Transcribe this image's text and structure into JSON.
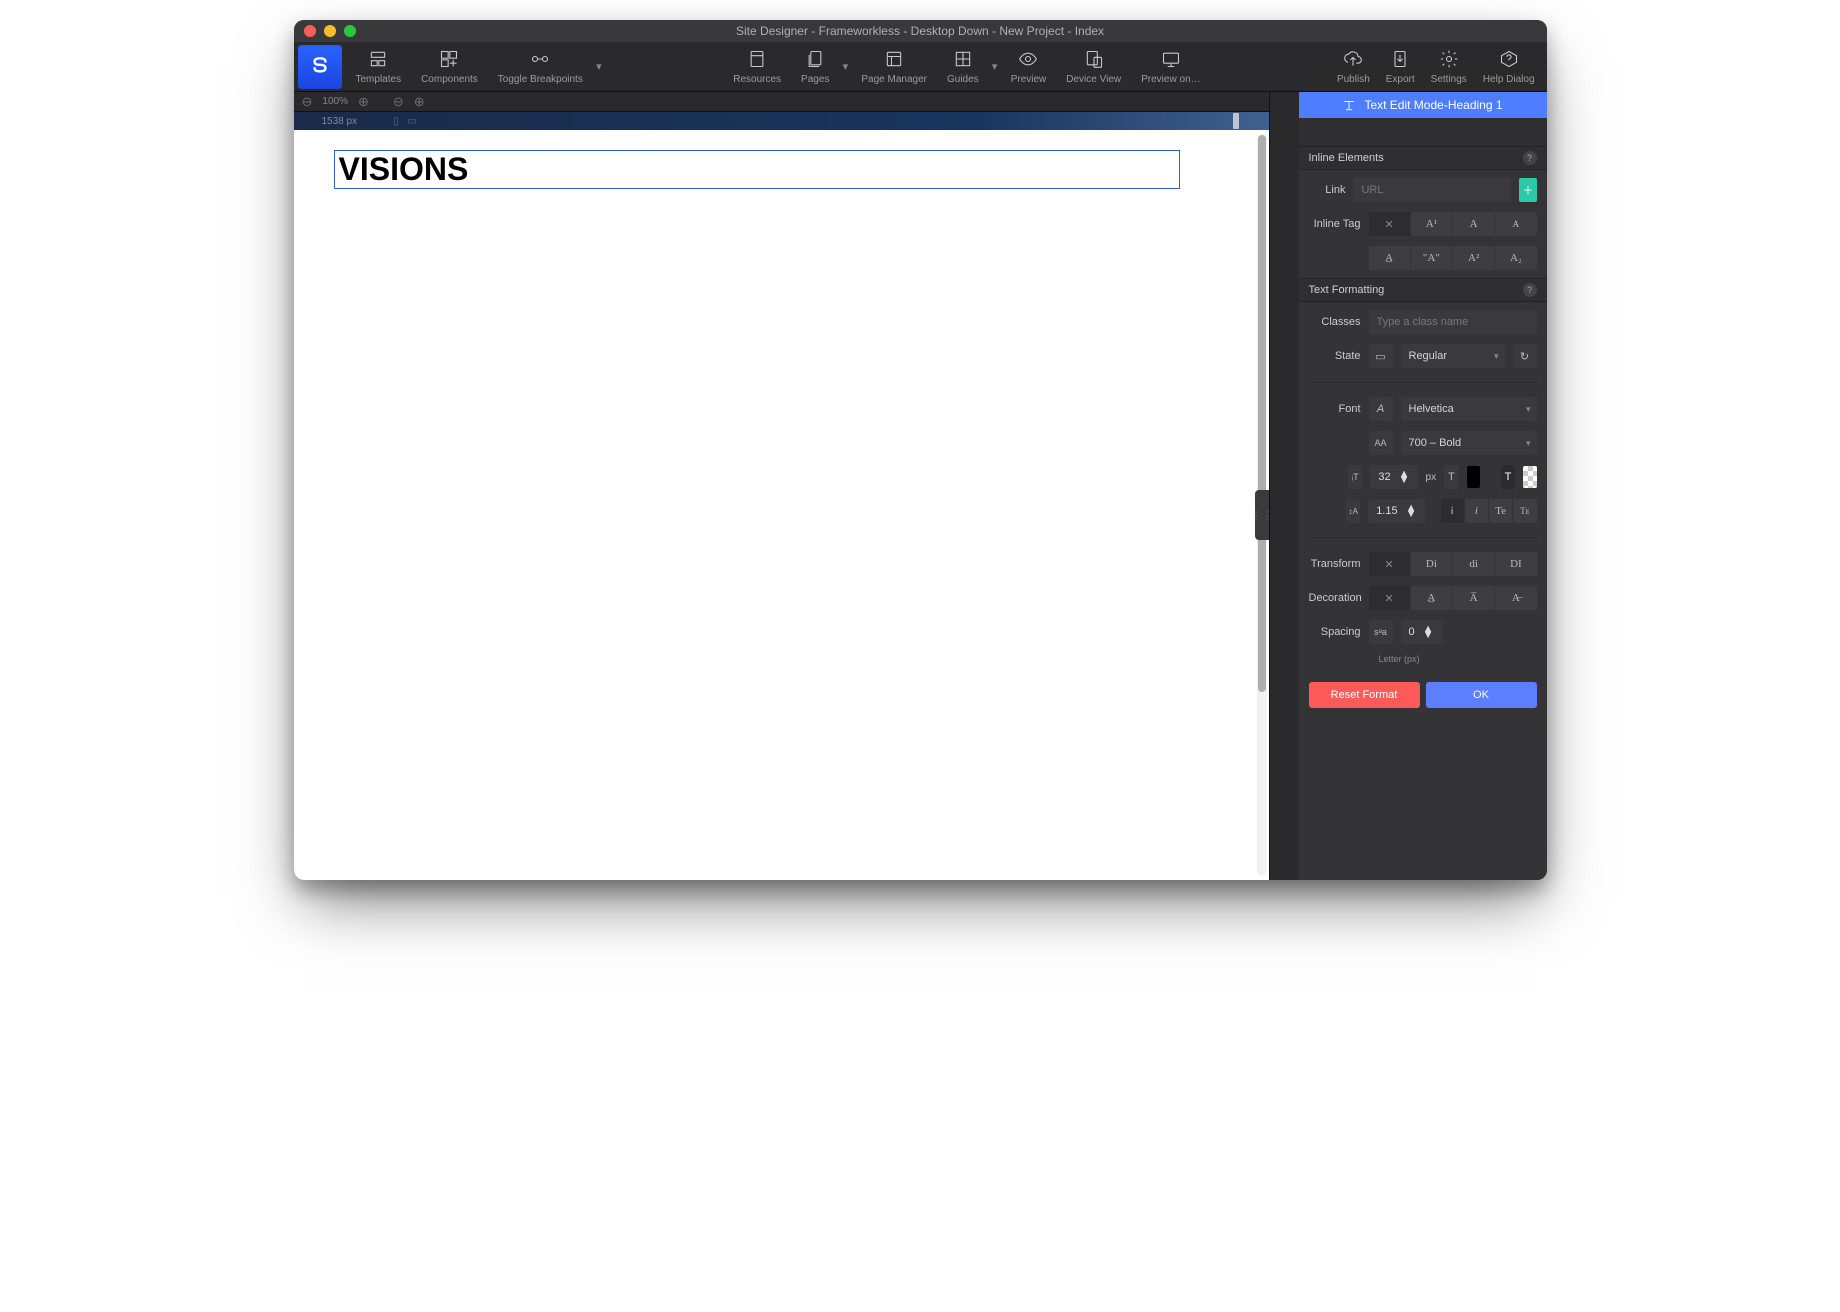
{
  "title": "Site Designer - Frameworkless - Desktop Down - New Project - Index",
  "toolbar_left": [
    {
      "label": "Templates",
      "icon": "templates"
    },
    {
      "label": "Components",
      "icon": "components"
    },
    {
      "label": "Toggle Breakpoints",
      "icon": "breakpoints"
    }
  ],
  "toolbar_center": [
    {
      "label": "Resources",
      "icon": "resources"
    },
    {
      "label": "Pages",
      "icon": "pages",
      "caret": true
    },
    {
      "label": "Page Manager",
      "icon": "pagemgr"
    },
    {
      "label": "Guides",
      "icon": "guides",
      "caret": true
    },
    {
      "label": "Preview",
      "icon": "preview"
    },
    {
      "label": "Device View",
      "icon": "device"
    },
    {
      "label": "Preview on…",
      "icon": "previewon"
    }
  ],
  "toolbar_right": [
    {
      "label": "Publish",
      "icon": "publish"
    },
    {
      "label": "Export",
      "icon": "export"
    },
    {
      "label": "Settings",
      "icon": "settings"
    },
    {
      "label": "Help Dialog",
      "icon": "help"
    }
  ],
  "zoom": {
    "percent": "100%"
  },
  "breakpoint": {
    "width": "1538 px"
  },
  "canvas": {
    "heading_text": "VISIONS"
  },
  "mode_bar": "Text Edit Mode-Heading 1",
  "sections": {
    "inline_elements": "Inline Elements",
    "text_formatting": "Text Formatting"
  },
  "inline": {
    "link_label": "Link",
    "link_placeholder": "URL",
    "tag_label": "Inline Tag",
    "tag_row1": [
      "✕",
      "A¹",
      "A",
      "A"
    ],
    "tag_row2": [
      "A̲",
      "\"A\"",
      "A²",
      "A₂"
    ]
  },
  "fmt": {
    "classes_label": "Classes",
    "classes_placeholder": "Type a class name",
    "state_label": "State",
    "state_value": "Regular",
    "font_label": "Font",
    "font_value": "Helvetica",
    "weight_value": "700 – Bold",
    "size_value": "32",
    "size_unit": "px",
    "lineheight_value": "1.15",
    "style_btns": [
      "i",
      "i",
      "Te",
      "Tᴇ"
    ],
    "transform_label": "Transform",
    "transform_btns": [
      "✕",
      "Di",
      "di",
      "DI"
    ],
    "decoration_label": "Decoration",
    "decoration_btns": [
      "✕",
      "A̲",
      "A̅",
      "A̶"
    ],
    "spacing_label": "Spacing",
    "spacing_icon": "sᵃa",
    "spacing_value": "0",
    "spacing_sub": "Letter (px)",
    "reset_label": "Reset Format",
    "ok_label": "OK"
  }
}
